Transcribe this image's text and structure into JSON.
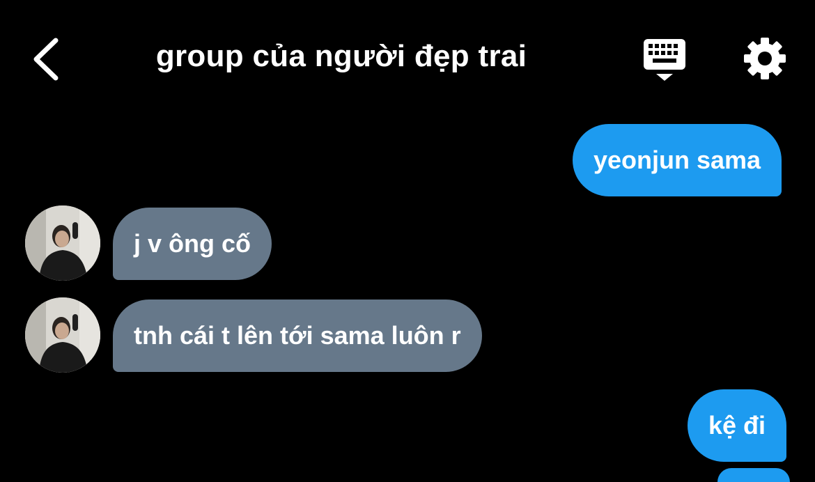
{
  "header": {
    "title": "group của người đẹp trai",
    "back_icon": "chevron-left-icon",
    "keyboard_icon": "keyboard-icon",
    "settings_icon": "gear-icon"
  },
  "messages": [
    {
      "direction": "outgoing",
      "text": "yeonjun sama"
    },
    {
      "direction": "incoming",
      "text": "j v ông cố",
      "avatar": "user-avatar"
    },
    {
      "direction": "incoming",
      "text": "tnh cái t lên tới sama luôn r",
      "avatar": "user-avatar"
    },
    {
      "direction": "outgoing",
      "text": "kệ đi"
    }
  ],
  "colors": {
    "background": "#000000",
    "outgoing_bubble": "#1d9bf0",
    "incoming_bubble": "#66788a",
    "text": "#ffffff"
  }
}
